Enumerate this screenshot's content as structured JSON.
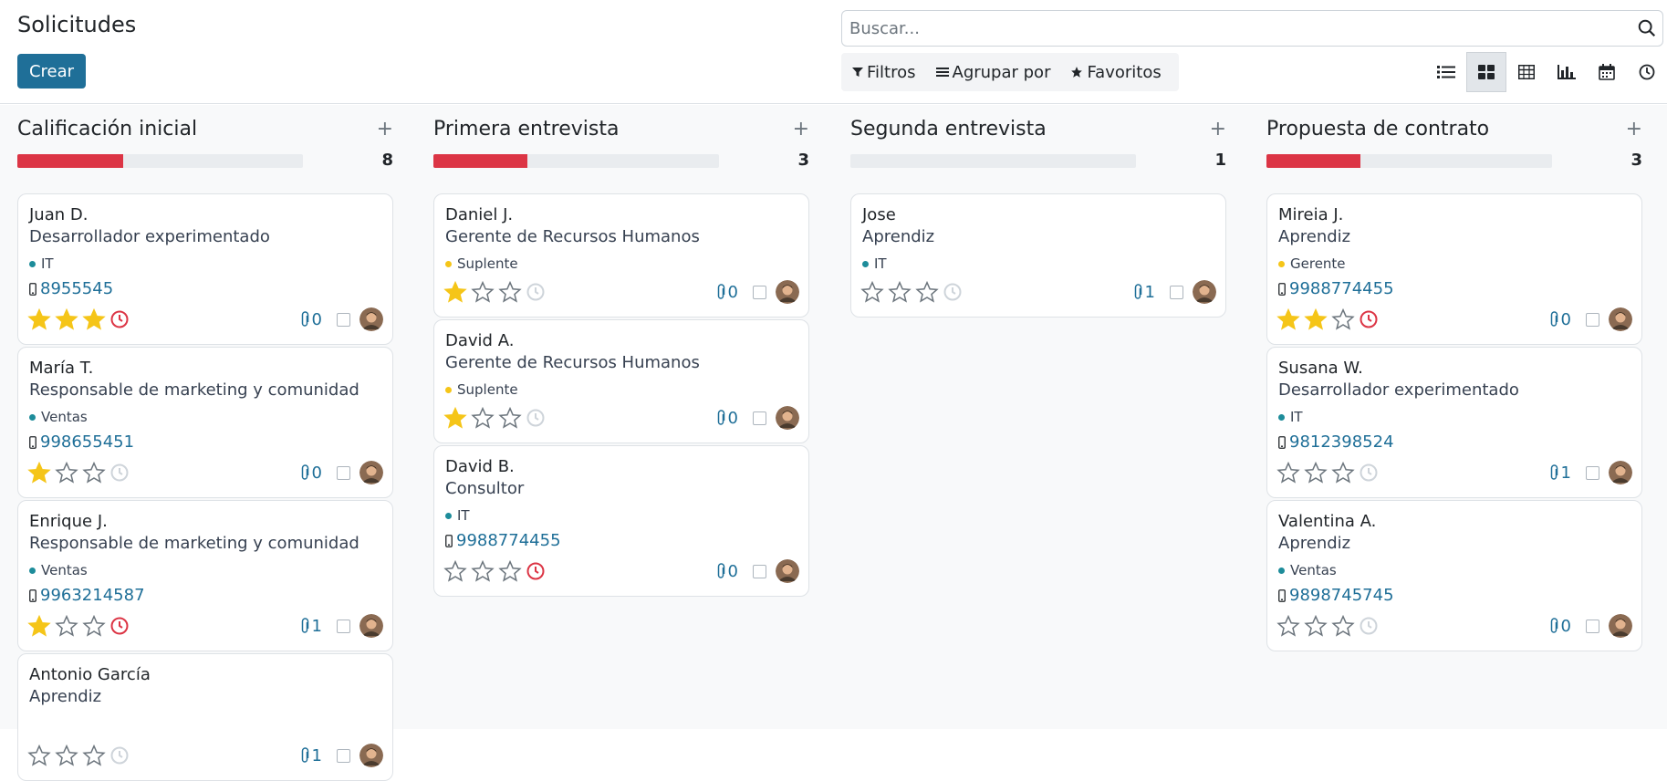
{
  "title": "Solicitudes",
  "create_label": "Crear",
  "search": {
    "placeholder": "Buscar..."
  },
  "filters": {
    "filters_label": "Filtros",
    "group_label": "Agrupar por",
    "favorites_label": "Favoritos"
  },
  "views": [
    "list",
    "kanban",
    "pivot",
    "graph",
    "calendar",
    "activity"
  ],
  "active_view": "kanban",
  "colors": {
    "accent": "#1f6f98",
    "danger": "#dc3545",
    "star": "#f5c518",
    "tag_teal": "#1d8c9a",
    "tag_yellow": "#f5c518"
  },
  "columns": [
    {
      "title": "Calificación inicial",
      "count": "8",
      "progress": 0.37,
      "cards": [
        {
          "name": "Juan D.",
          "job": "Desarrollador experimentado",
          "tag": "IT",
          "tag_color": "teal",
          "phone": "8955545",
          "stars": 3,
          "clock_overdue": true,
          "attach": "0"
        },
        {
          "name": "María T.",
          "job": "Responsable de marketing y comunidad",
          "tag": "Ventas",
          "tag_color": "teal",
          "phone": "998655451",
          "stars": 1,
          "clock_overdue": false,
          "attach": "0"
        },
        {
          "name": "Enrique J.",
          "job": "Responsable de marketing y comunidad",
          "tag": "Ventas",
          "tag_color": "teal",
          "phone": "9963214587",
          "stars": 1,
          "clock_overdue": true,
          "attach": "1"
        },
        {
          "name": "Antonio García",
          "job": "Aprendiz",
          "tag": "",
          "tag_color": "",
          "phone": "",
          "stars": 0,
          "clock_overdue": false,
          "attach": "1"
        }
      ]
    },
    {
      "title": "Primera entrevista",
      "count": "3",
      "progress": 0.33,
      "cards": [
        {
          "name": "Daniel J.",
          "job": "Gerente de Recursos Humanos",
          "tag": "Suplente",
          "tag_color": "yellow",
          "phone": "",
          "stars": 1,
          "clock_overdue": false,
          "attach": "0"
        },
        {
          "name": "David A.",
          "job": "Gerente de Recursos Humanos",
          "tag": "Suplente",
          "tag_color": "yellow",
          "phone": "",
          "stars": 1,
          "clock_overdue": false,
          "attach": "0"
        },
        {
          "name": "David B.",
          "job": "Consultor",
          "tag": "IT",
          "tag_color": "teal",
          "phone": "9988774455",
          "stars": 0,
          "clock_overdue": true,
          "attach": "0"
        }
      ]
    },
    {
      "title": "Segunda entrevista",
      "count": "1",
      "progress": 0,
      "cards": [
        {
          "name": "Jose",
          "job": "Aprendiz",
          "tag": "IT",
          "tag_color": "teal",
          "phone": "",
          "stars": 0,
          "clock_overdue": false,
          "attach": "1"
        }
      ]
    },
    {
      "title": "Propuesta de contrato",
      "count": "3",
      "progress": 0.33,
      "cards": [
        {
          "name": "Mireia J.",
          "job": "Aprendiz",
          "tag": "Gerente",
          "tag_color": "yellow",
          "phone": "9988774455",
          "stars": 2,
          "clock_overdue": true,
          "attach": "0"
        },
        {
          "name": "Susana W.",
          "job": "Desarrollador experimentado",
          "tag": "IT",
          "tag_color": "teal",
          "phone": "9812398524",
          "stars": 0,
          "clock_overdue": false,
          "attach": "1"
        },
        {
          "name": "Valentina A.",
          "job": "Aprendiz",
          "tag": "Ventas",
          "tag_color": "teal",
          "phone": "9898745745",
          "stars": 0,
          "clock_overdue": false,
          "attach": "0"
        }
      ]
    }
  ]
}
